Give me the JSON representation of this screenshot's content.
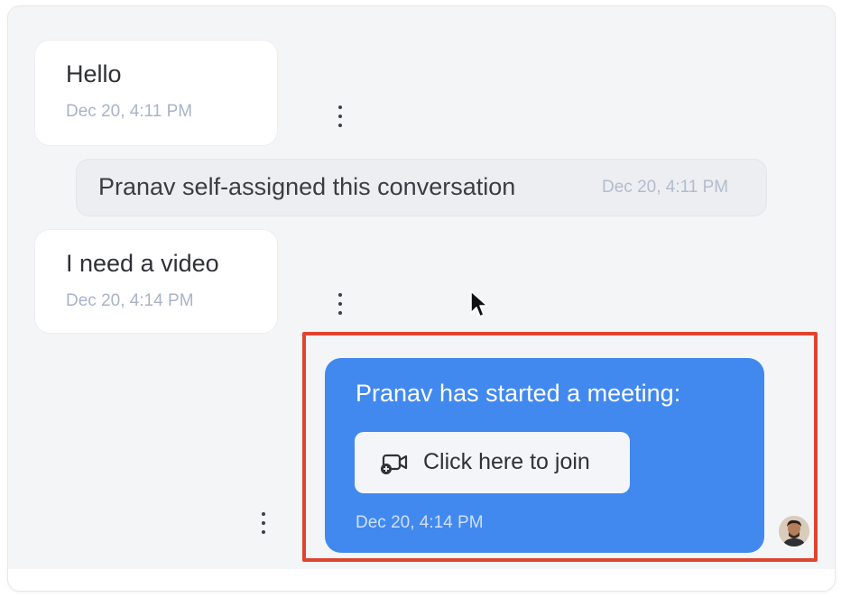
{
  "messages": [
    {
      "text": "Hello",
      "time": "Dec 20, 4:11 PM"
    },
    {
      "text": "I need a video",
      "time": "Dec 20, 4:14 PM"
    }
  ],
  "activity": {
    "text": "Pranav self-assigned this conversation",
    "time": "Dec 20, 4:11 PM"
  },
  "meeting": {
    "text": "Pranav has started a meeting:",
    "button_label": "Click here to join",
    "button_icon": "video-plus-icon",
    "time": "Dec 20, 4:14 PM"
  },
  "colors": {
    "outgoing_bubble": "#4189ef",
    "highlight_border": "#e0432f",
    "chat_background": "#f4f5f7",
    "timestamp": "#a9b3c7"
  },
  "icons": {
    "message_actions": "more-vertical-icon",
    "agent_avatar": "avatar",
    "pointer": "mouse-cursor-icon"
  }
}
